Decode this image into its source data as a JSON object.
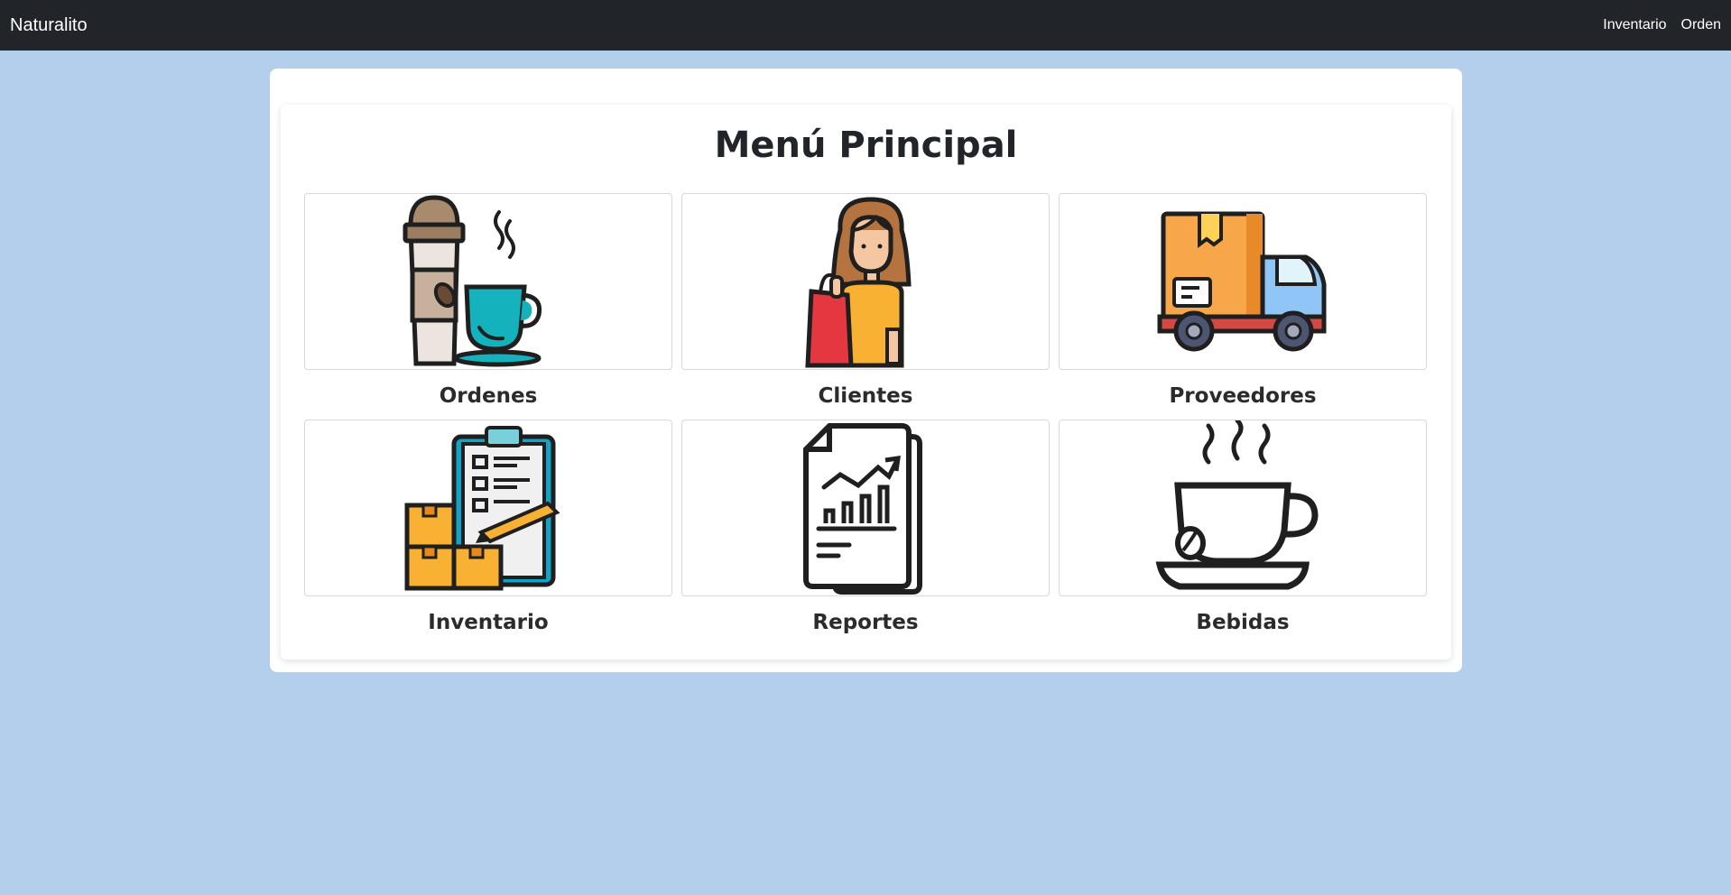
{
  "navbar": {
    "brand": "Naturalito",
    "links": [
      "Inventario",
      "Orden"
    ]
  },
  "main": {
    "title": "Menú Principal",
    "tiles": [
      {
        "label": "Ordenes",
        "icon": "coffee-cups-icon"
      },
      {
        "label": "Clientes",
        "icon": "customer-shopping-icon"
      },
      {
        "label": "Proveedores",
        "icon": "delivery-truck-icon"
      },
      {
        "label": "Inventario",
        "icon": "inventory-clipboard-icon"
      },
      {
        "label": "Reportes",
        "icon": "report-chart-icon"
      },
      {
        "label": "Bebidas",
        "icon": "hot-cup-icon"
      }
    ]
  },
  "colors": {
    "navbar_bg": "#212529",
    "page_bg": "#b4cfec",
    "card_bg": "#ffffff"
  }
}
